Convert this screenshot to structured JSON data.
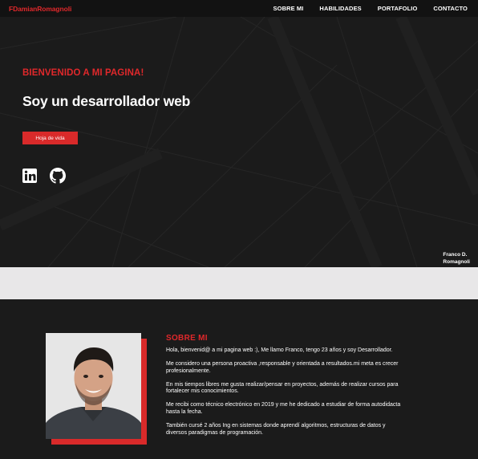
{
  "brand": "FDamianRomagnoli",
  "nav": {
    "items": [
      "SOBRE MI",
      "HABILIDADES",
      "PORTAFOLIO",
      "CONTACTO"
    ]
  },
  "hero": {
    "welcome": "BIENVENIDO A MI PAGINA!",
    "headline": "Soy un desarrollador web",
    "cv_button": "Hoja de vida",
    "credit_line1": "Franco D.",
    "credit_line2": "Romagnoli"
  },
  "about": {
    "title": "SOBRE MI",
    "paragraphs": [
      "Hola, bienvenid@ a mi pagina web :), Me llamo Franco, tengo 23 años y soy Desarrollador.",
      "Me considero una persona proactiva ,responsable y orientada a resultados.mi meta es crecer profesionalmente.",
      "En mis tiempos libres me gusta realizar/pensar en proyectos, además de realizar cursos para fortalecer mis conocimientos.",
      "Me recibi como técnico electrónico en 2019 y me he dedicado a estudiar de forma autodidacta hasta la fecha.",
      "También cursé 2 años Ing en sistemas donde aprendí algoritmos, estructuras de datos y diversos paradigmas de programación."
    ]
  },
  "colors": {
    "accent": "#e0282b",
    "background": "#1b1b1b",
    "band": "#e8e7e8"
  },
  "icons": [
    "linkedin-icon",
    "github-icon"
  ]
}
